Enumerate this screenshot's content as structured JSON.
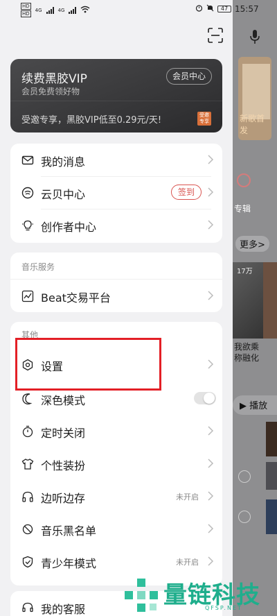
{
  "status_bar": {
    "left_sim1": "HD",
    "left_sim2": "HD",
    "net1": "4G",
    "net2": "4G",
    "battery": "47",
    "time": "15:57"
  },
  "vip_card": {
    "title": "续费黑胶VIP",
    "subtitle": "会员免费领好物",
    "member_center_label": "会员中心",
    "promo_text": "受邀专享，黑胶VIP低至0.29元/天!",
    "tag_text": "受邀专享"
  },
  "menu_group1": {
    "items": [
      {
        "label": "我的消息",
        "icon": "mail-icon"
      },
      {
        "label": "云贝中心",
        "icon": "coin-icon",
        "badge": "签到"
      },
      {
        "label": "创作者中心",
        "icon": "bulb-icon"
      }
    ]
  },
  "menu_group2": {
    "section_title": "音乐服务",
    "items": [
      {
        "label": "Beat交易平台",
        "icon": "chart-icon"
      }
    ]
  },
  "menu_group3": {
    "section_title": "其他",
    "items": [
      {
        "label": "设置",
        "icon": "settings-icon"
      },
      {
        "label": "深色模式",
        "icon": "moon-icon",
        "toggle": "off"
      },
      {
        "label": "定时关闭",
        "icon": "timer-icon"
      },
      {
        "label": "个性装扮",
        "icon": "shirt-icon"
      },
      {
        "label": "边听边存",
        "icon": "headphones-icon",
        "note": "未开启"
      },
      {
        "label": "音乐黑名单",
        "icon": "block-icon"
      },
      {
        "label": "青少年模式",
        "icon": "shield-icon",
        "note": "未开启"
      }
    ]
  },
  "menu_group4": {
    "items": [
      {
        "label": "我的客服",
        "icon": "headset-icon"
      }
    ]
  },
  "background_app": {
    "album_caption": "新歌首发",
    "tab_label": "专辑",
    "more_label": "更多>",
    "count_label": "17万",
    "song_text": "我欲乘\n称融化",
    "play_label": "播放"
  },
  "watermark": {
    "text": "量链科技",
    "sub": "QFSP.NET"
  },
  "colors": {
    "accent_red": "#d9534f",
    "highlight_red": "#e31f26",
    "watermark_green": "#1fae8c"
  }
}
